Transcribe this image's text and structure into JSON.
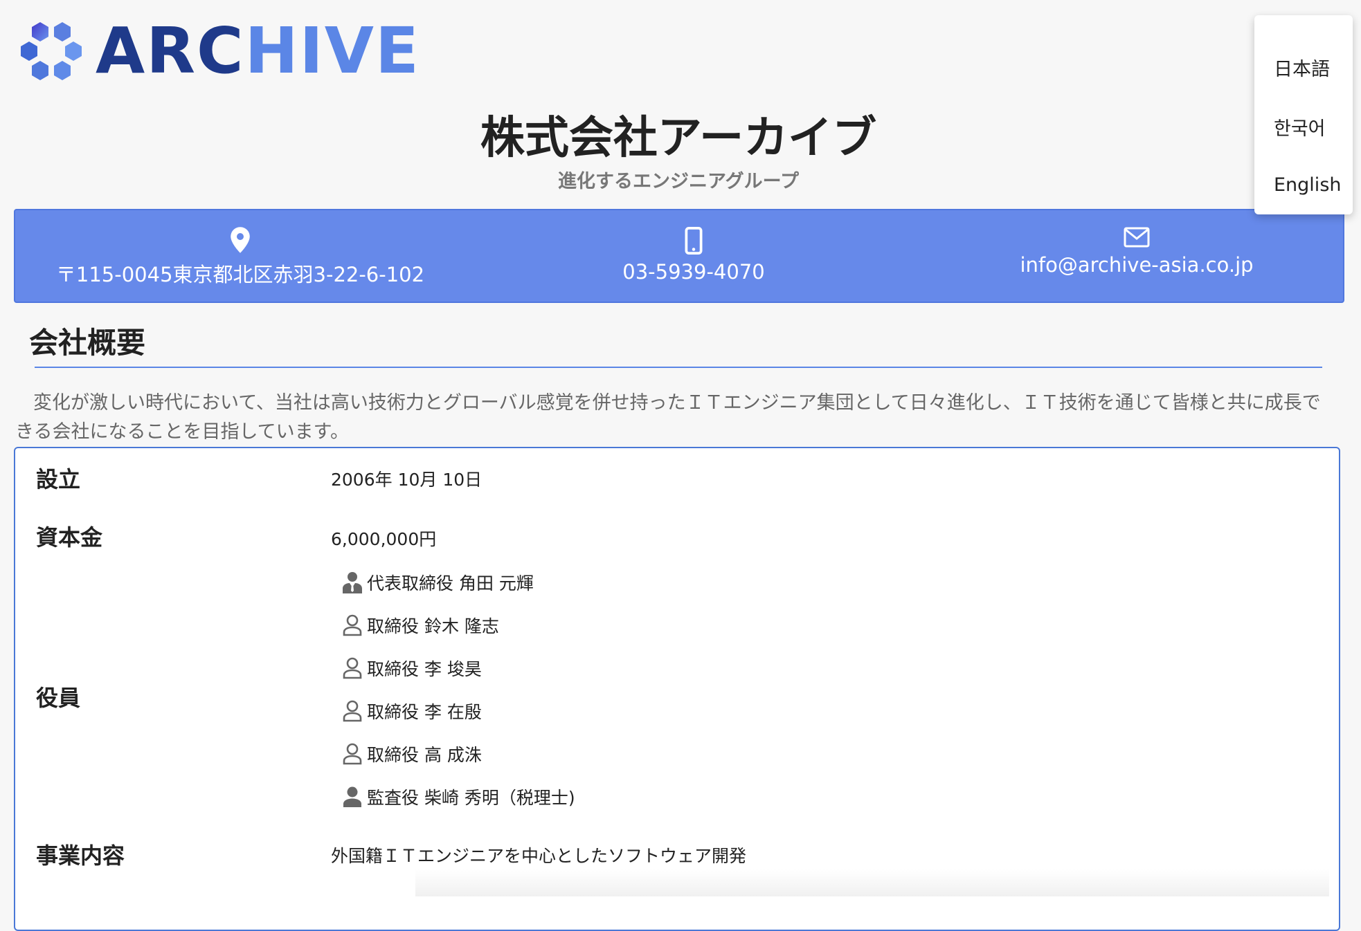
{
  "logo": {
    "part1": "ARC",
    "part2": "HIVE"
  },
  "company": {
    "name": "株式会社アーカイブ",
    "tagline": "進化するエンジニアグループ"
  },
  "language_menu": {
    "items": [
      "日本語",
      "한국어",
      "English"
    ]
  },
  "contact": {
    "address": "〒115-0045東京都北区赤羽3-22-6-102",
    "phone": "03-5939-4070",
    "email": "info@archive-asia.co.jp"
  },
  "overview": {
    "heading": "会社概要",
    "intro": "変化が激しい時代において、当社は高い技術力とグローバル感覚を併せ持ったＩＴエンジニア集団として日々進化し、ＩＴ技術を通じて皆様と共に成長できる会社になることを目指しています。"
  },
  "info": {
    "established_label": "設立",
    "established_value": "2006年 10月 10日",
    "capital_label": "資本金",
    "capital_value": "6,000,000円",
    "officers_label": "役員",
    "officers": [
      {
        "text": "代表取締役 角田 元輝",
        "icon": "businessman-icon"
      },
      {
        "text": "取締役 鈴木 隆志",
        "icon": "person-outline-icon"
      },
      {
        "text": "取締役 李 埈昊",
        "icon": "person-outline-icon"
      },
      {
        "text": "取締役 李 在殷",
        "icon": "person-outline-icon"
      },
      {
        "text": "取締役 高 成洙",
        "icon": "person-outline-icon"
      },
      {
        "text": "監査役 柴崎 秀明（税理士)",
        "icon": "person-filled-icon"
      }
    ],
    "business_label": "事業内容",
    "business_value": "外国籍ＩＴエンジニアを中心としたソフトウェア開発"
  },
  "colors": {
    "brand_dark": "#1f3a8a",
    "brand_light": "#5b86e6",
    "contact_bar": "#6689ea",
    "box_border": "#4a78d6"
  }
}
